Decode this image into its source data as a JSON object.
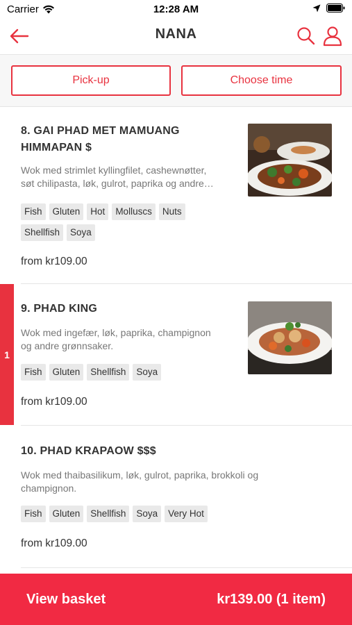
{
  "status": {
    "carrier": "Carrier",
    "time": "12:28 AM"
  },
  "nav": {
    "title": "NANA"
  },
  "actions": {
    "pickup": "Pick-up",
    "choose_time": "Choose time"
  },
  "items": [
    {
      "name_line1": "8. GAI PHAD MET MAMUANG",
      "name_line2": "HIMMAPAN $",
      "desc_line1": "Wok med strimlet kyllingfilet, cashewnøtter,",
      "desc_line2": "søt chilipasta, løk, gulrot, paprika og andre…",
      "tags": [
        "Fish",
        "Gluten",
        "Hot",
        "Molluscs",
        "Nuts",
        "Shellfish",
        "Soya"
      ],
      "price": "from kr109.00"
    },
    {
      "name_line1": "9. PHAD KING",
      "desc_line1": "Wok med ingefær, løk, paprika, champignon",
      "desc_line2": "og andre grønnsaker.",
      "tags": [
        "Fish",
        "Gluten",
        "Shellfish",
        "Soya"
      ],
      "price": "from kr109.00",
      "quantity": "1"
    },
    {
      "name_line1": "10. PHAD KRAPAOW $$$",
      "desc_line1": "Wok med thaibasilikum, løk, gulrot, paprika, brokkoli og",
      "desc_line2": "champignon.",
      "tags": [
        "Fish",
        "Gluten",
        "Shellfish",
        "Soya",
        "Very Hot"
      ],
      "price": "from kr109.00"
    }
  ],
  "basket": {
    "label": "View basket",
    "total": "kr139.00 (1 item)"
  },
  "colors": {
    "accent": "#e8323f",
    "basket": "#f12a43"
  }
}
